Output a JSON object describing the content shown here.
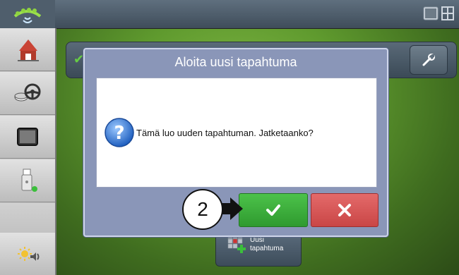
{
  "dialog": {
    "title": "Aloita uusi tapahtuma",
    "message": "Tämä luo uuden tapahtuman. Jatketaanko?",
    "confirm_icon": "checkmark-icon",
    "cancel_icon": "x-icon",
    "info_icon": "question-mark-icon"
  },
  "callout": {
    "number": "2"
  },
  "background_button": {
    "label": "Uusi tapahtuma",
    "icon": "new-event-grid-icon"
  },
  "sidebar": {
    "items": [
      {
        "icon": "farm-barn-icon"
      },
      {
        "icon": "steering-wheel-icon"
      },
      {
        "icon": "display-monitor-icon"
      },
      {
        "icon": "usb-drive-icon"
      },
      {
        "icon": "blank"
      },
      {
        "icon": "brightness-volume-icon"
      }
    ]
  },
  "topbar": {
    "logo_icon": "gps-logo-icon",
    "map_toggle_icon": "map-toggle-icon"
  },
  "colors": {
    "confirm": "#3aad3a",
    "cancel": "#d55555",
    "dialog_frame": "#8a96b8",
    "field_green": "#5f9a2e"
  }
}
